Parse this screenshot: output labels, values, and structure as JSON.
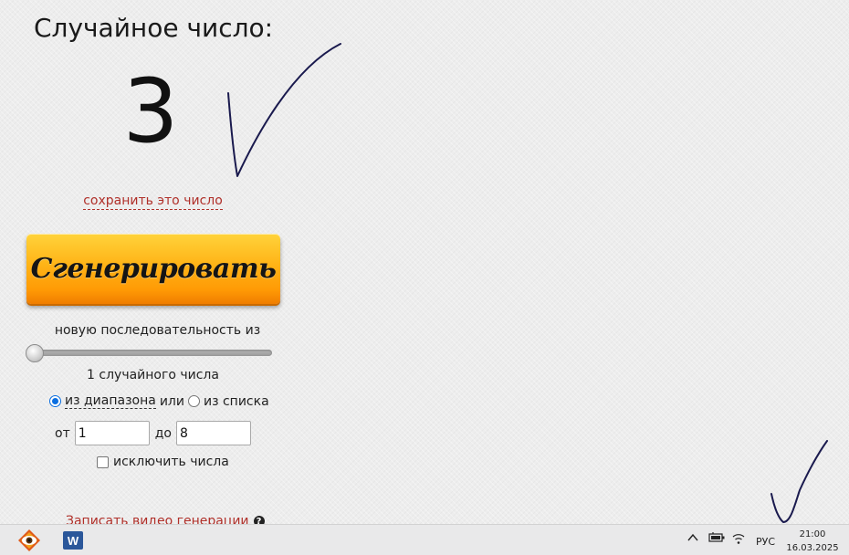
{
  "page": {
    "title": "Случайное число:",
    "result": "3",
    "save_link": "сохранить это число",
    "generate_button": "Сгенерировать",
    "sequence_label": "новую последовательность из",
    "count_label": "1 случайного числа",
    "range_option_label": "из диапазона",
    "or_label": "или",
    "list_option_label": "из списка",
    "from_label": "от",
    "from_value": "1",
    "to_label": "до",
    "to_value": "8",
    "exclude_label": "исключить числа",
    "video_link": "Записать видео генерации",
    "help_icon_text": "?"
  },
  "colors": {
    "link": "#b0302a",
    "button_top": "#ffd33b",
    "button_bottom": "#f07d00",
    "checkmark": "#1a1a4e",
    "radio_selected": "#0a6ee0"
  },
  "taskbar": {
    "apps": [
      {
        "name": "eye-app-icon"
      },
      {
        "name": "word-icon",
        "letter": "W"
      }
    ],
    "tray": {
      "language": "РУС",
      "time": "21:00",
      "date": "16.03.2025"
    }
  }
}
